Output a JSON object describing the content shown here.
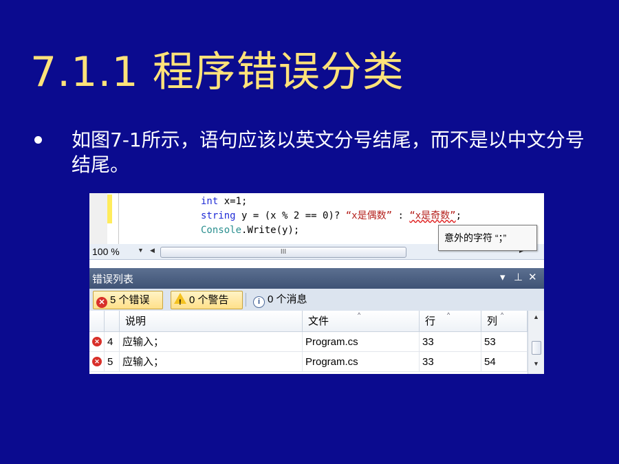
{
  "slide": {
    "title": "7.1.1  程序错误分类",
    "bullet": "如图7-1所示，语句应该以英文分号结尾，而不是以中文分号结尾。"
  },
  "editor": {
    "line1": {
      "kw": "int",
      "rest": " x=1;"
    },
    "line2": {
      "kw": "string",
      "mid": " y = (x % 2 == 0)? ",
      "s1": "“x是偶数”",
      "colon": " : ",
      "s2": "“x是奇数”",
      "end": ";"
    },
    "line3": {
      "type": "Console",
      "rest": ".Write(y);"
    },
    "tooltip": "意外的字符 “；”",
    "zoom": "100 %",
    "thumb_grip": "III"
  },
  "error_list": {
    "title": "错误列表",
    "pin_glyph": "▾ 1 ×",
    "errors_label": "5 个错误",
    "warnings_label": "0 个警告",
    "messages_label": "0 个消息",
    "columns": [
      "说明",
      "文件",
      "行",
      "列"
    ],
    "rows": [
      {
        "num": "4",
        "desc": "应输入；",
        "file": "Program.cs",
        "line": "33",
        "col": "53"
      },
      {
        "num": "5",
        "desc": "应输入；",
        "file": "Program.cs",
        "line": "33",
        "col": "54"
      }
    ]
  },
  "colors": {
    "background": "#0b0b8f",
    "title": "#ffe27a",
    "header": "#4b5f82"
  }
}
